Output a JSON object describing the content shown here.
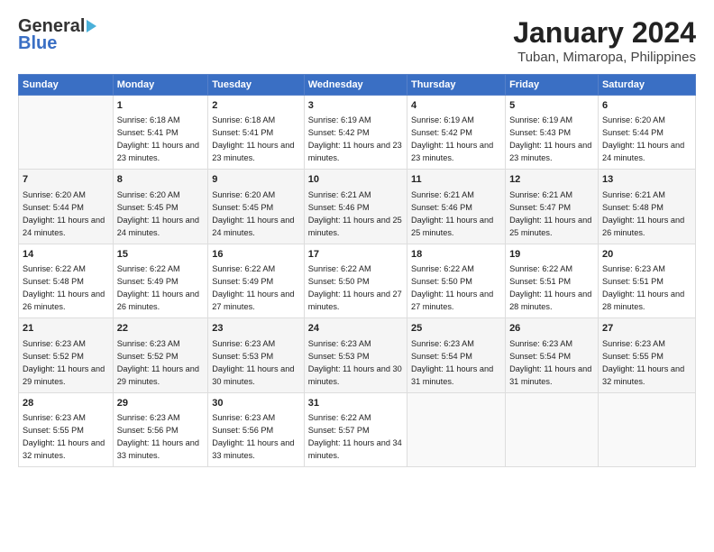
{
  "header": {
    "logo_line1": "General",
    "logo_line2": "Blue",
    "title": "January 2024",
    "subtitle": "Tuban, Mimaropa, Philippines"
  },
  "days_of_week": [
    "Sunday",
    "Monday",
    "Tuesday",
    "Wednesday",
    "Thursday",
    "Friday",
    "Saturday"
  ],
  "weeks": [
    {
      "cells": [
        {
          "day": "",
          "sunrise": "",
          "sunset": "",
          "daylight": ""
        },
        {
          "day": "1",
          "sunrise": "Sunrise: 6:18 AM",
          "sunset": "Sunset: 5:41 PM",
          "daylight": "Daylight: 11 hours and 23 minutes."
        },
        {
          "day": "2",
          "sunrise": "Sunrise: 6:18 AM",
          "sunset": "Sunset: 5:41 PM",
          "daylight": "Daylight: 11 hours and 23 minutes."
        },
        {
          "day": "3",
          "sunrise": "Sunrise: 6:19 AM",
          "sunset": "Sunset: 5:42 PM",
          "daylight": "Daylight: 11 hours and 23 minutes."
        },
        {
          "day": "4",
          "sunrise": "Sunrise: 6:19 AM",
          "sunset": "Sunset: 5:42 PM",
          "daylight": "Daylight: 11 hours and 23 minutes."
        },
        {
          "day": "5",
          "sunrise": "Sunrise: 6:19 AM",
          "sunset": "Sunset: 5:43 PM",
          "daylight": "Daylight: 11 hours and 23 minutes."
        },
        {
          "day": "6",
          "sunrise": "Sunrise: 6:20 AM",
          "sunset": "Sunset: 5:44 PM",
          "daylight": "Daylight: 11 hours and 24 minutes."
        }
      ]
    },
    {
      "cells": [
        {
          "day": "7",
          "sunrise": "Sunrise: 6:20 AM",
          "sunset": "Sunset: 5:44 PM",
          "daylight": "Daylight: 11 hours and 24 minutes."
        },
        {
          "day": "8",
          "sunrise": "Sunrise: 6:20 AM",
          "sunset": "Sunset: 5:45 PM",
          "daylight": "Daylight: 11 hours and 24 minutes."
        },
        {
          "day": "9",
          "sunrise": "Sunrise: 6:20 AM",
          "sunset": "Sunset: 5:45 PM",
          "daylight": "Daylight: 11 hours and 24 minutes."
        },
        {
          "day": "10",
          "sunrise": "Sunrise: 6:21 AM",
          "sunset": "Sunset: 5:46 PM",
          "daylight": "Daylight: 11 hours and 25 minutes."
        },
        {
          "day": "11",
          "sunrise": "Sunrise: 6:21 AM",
          "sunset": "Sunset: 5:46 PM",
          "daylight": "Daylight: 11 hours and 25 minutes."
        },
        {
          "day": "12",
          "sunrise": "Sunrise: 6:21 AM",
          "sunset": "Sunset: 5:47 PM",
          "daylight": "Daylight: 11 hours and 25 minutes."
        },
        {
          "day": "13",
          "sunrise": "Sunrise: 6:21 AM",
          "sunset": "Sunset: 5:48 PM",
          "daylight": "Daylight: 11 hours and 26 minutes."
        }
      ]
    },
    {
      "cells": [
        {
          "day": "14",
          "sunrise": "Sunrise: 6:22 AM",
          "sunset": "Sunset: 5:48 PM",
          "daylight": "Daylight: 11 hours and 26 minutes."
        },
        {
          "day": "15",
          "sunrise": "Sunrise: 6:22 AM",
          "sunset": "Sunset: 5:49 PM",
          "daylight": "Daylight: 11 hours and 26 minutes."
        },
        {
          "day": "16",
          "sunrise": "Sunrise: 6:22 AM",
          "sunset": "Sunset: 5:49 PM",
          "daylight": "Daylight: 11 hours and 27 minutes."
        },
        {
          "day": "17",
          "sunrise": "Sunrise: 6:22 AM",
          "sunset": "Sunset: 5:50 PM",
          "daylight": "Daylight: 11 hours and 27 minutes."
        },
        {
          "day": "18",
          "sunrise": "Sunrise: 6:22 AM",
          "sunset": "Sunset: 5:50 PM",
          "daylight": "Daylight: 11 hours and 27 minutes."
        },
        {
          "day": "19",
          "sunrise": "Sunrise: 6:22 AM",
          "sunset": "Sunset: 5:51 PM",
          "daylight": "Daylight: 11 hours and 28 minutes."
        },
        {
          "day": "20",
          "sunrise": "Sunrise: 6:23 AM",
          "sunset": "Sunset: 5:51 PM",
          "daylight": "Daylight: 11 hours and 28 minutes."
        }
      ]
    },
    {
      "cells": [
        {
          "day": "21",
          "sunrise": "Sunrise: 6:23 AM",
          "sunset": "Sunset: 5:52 PM",
          "daylight": "Daylight: 11 hours and 29 minutes."
        },
        {
          "day": "22",
          "sunrise": "Sunrise: 6:23 AM",
          "sunset": "Sunset: 5:52 PM",
          "daylight": "Daylight: 11 hours and 29 minutes."
        },
        {
          "day": "23",
          "sunrise": "Sunrise: 6:23 AM",
          "sunset": "Sunset: 5:53 PM",
          "daylight": "Daylight: 11 hours and 30 minutes."
        },
        {
          "day": "24",
          "sunrise": "Sunrise: 6:23 AM",
          "sunset": "Sunset: 5:53 PM",
          "daylight": "Daylight: 11 hours and 30 minutes."
        },
        {
          "day": "25",
          "sunrise": "Sunrise: 6:23 AM",
          "sunset": "Sunset: 5:54 PM",
          "daylight": "Daylight: 11 hours and 31 minutes."
        },
        {
          "day": "26",
          "sunrise": "Sunrise: 6:23 AM",
          "sunset": "Sunset: 5:54 PM",
          "daylight": "Daylight: 11 hours and 31 minutes."
        },
        {
          "day": "27",
          "sunrise": "Sunrise: 6:23 AM",
          "sunset": "Sunset: 5:55 PM",
          "daylight": "Daylight: 11 hours and 32 minutes."
        }
      ]
    },
    {
      "cells": [
        {
          "day": "28",
          "sunrise": "Sunrise: 6:23 AM",
          "sunset": "Sunset: 5:55 PM",
          "daylight": "Daylight: 11 hours and 32 minutes."
        },
        {
          "day": "29",
          "sunrise": "Sunrise: 6:23 AM",
          "sunset": "Sunset: 5:56 PM",
          "daylight": "Daylight: 11 hours and 33 minutes."
        },
        {
          "day": "30",
          "sunrise": "Sunrise: 6:23 AM",
          "sunset": "Sunset: 5:56 PM",
          "daylight": "Daylight: 11 hours and 33 minutes."
        },
        {
          "day": "31",
          "sunrise": "Sunrise: 6:22 AM",
          "sunset": "Sunset: 5:57 PM",
          "daylight": "Daylight: 11 hours and 34 minutes."
        },
        {
          "day": "",
          "sunrise": "",
          "sunset": "",
          "daylight": ""
        },
        {
          "day": "",
          "sunrise": "",
          "sunset": "",
          "daylight": ""
        },
        {
          "day": "",
          "sunrise": "",
          "sunset": "",
          "daylight": ""
        }
      ]
    }
  ]
}
